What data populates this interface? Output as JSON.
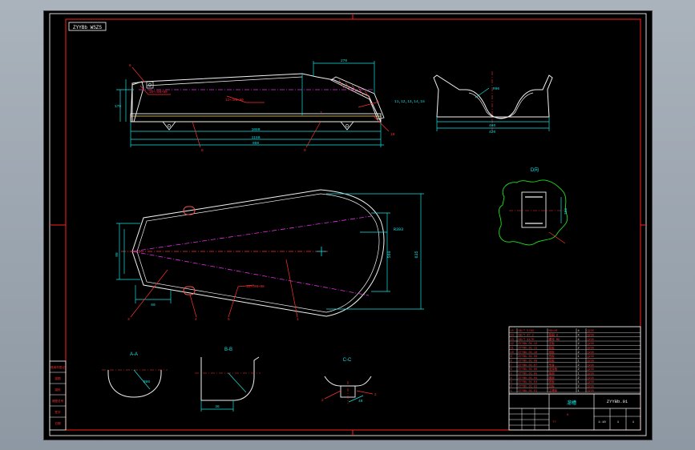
{
  "sheet": {
    "drawing_number_box": "ZYYBb WSZS"
  },
  "side_view": {
    "dims": {
      "top_len": "270",
      "overall_len_1": "1080",
      "overall_len_2": "1180",
      "inner_len": "950",
      "left_height": "170",
      "slope_note": "11,12,13,14,15"
    },
    "leaders": {
      "weld_1": "10×∠90×90",
      "weld_2": "12×∠80×80",
      "item_6": "6",
      "item_7": "7",
      "item_8": "8",
      "item_9": "9",
      "item_10": "10",
      "item_11": "11",
      "item_12": "12",
      "item_13": "13",
      "item_14": "14"
    }
  },
  "end_view": {
    "dims": {
      "width": "480",
      "inner_width": "420",
      "radius": "R96"
    }
  },
  "plan_view": {
    "dims": {
      "R": "R393",
      "width_560": "560",
      "width_635": "635",
      "left_w": "80",
      "offset": "60"
    },
    "leaders": {
      "item_1": "1",
      "item_2": "2",
      "item_4": "4",
      "item_5": "5",
      "item_3": "3",
      "weld": "16×∠90×90"
    }
  },
  "detail_d": {
    "label": "D向",
    "dim": "100"
  },
  "sections": {
    "aa": {
      "label": "A-A",
      "dim": "R86"
    },
    "bb": {
      "label": "B-B",
      "dim": "36"
    },
    "cc": {
      "label": "C-C",
      "leader_left": "2",
      "leader_right": "2",
      "dim": "40"
    }
  },
  "title_block": {
    "parts_rows": [
      [
        "15",
        "GB/T 5783",
        "M8×20",
        "4",
        "Q235"
      ],
      [
        "14",
        "GB/T 97.1",
        "垫圈 8",
        "4",
        "Q235"
      ],
      [
        "13",
        "GB/T 6170",
        "螺母 M8",
        "4",
        "Q235"
      ],
      [
        "12",
        "ZYYBb.01-12",
        "支板",
        "2",
        "Q235"
      ],
      [
        "11",
        "ZYYBb.01-11",
        "筋板",
        "2",
        "Q235"
      ],
      [
        "10",
        "ZYYBb.01-10",
        "侧板",
        "2",
        "Q235"
      ],
      [
        "9",
        "ZYYBb.01-09",
        "挡板",
        "1",
        "Q235"
      ],
      [
        "8",
        "ZYYBb.01-08",
        "底板",
        "1",
        "Q235"
      ],
      [
        "7",
        "ZYYBb.01-07",
        "吊耳",
        "2",
        "Q235"
      ],
      [
        "6",
        "ZYYBb.01-06",
        "连接板",
        "2",
        "Q235"
      ],
      [
        "5",
        "ZYYBb.01-05",
        "角钢",
        "1",
        "Q235"
      ],
      [
        "4",
        "ZYYBb.01-04",
        "圆钢",
        "2",
        "Q235"
      ],
      [
        "3",
        "ZYYBb.01-03",
        "弧板",
        "1",
        "Q235"
      ],
      [
        "2",
        "ZYYBb.01-02",
        "耳板",
        "2",
        "Q235"
      ],
      [
        "1",
        "ZYYBb.01-01",
        "主槽体",
        "1",
        "Q235"
      ]
    ],
    "name": "溜槽",
    "code": "ZYYBb.01",
    "scale": "1:10",
    "sheet": "1",
    "sheets": "1",
    "small_labels": [
      "S",
      "P",
      "?",
      "?",
      "??"
    ]
  },
  "left_strip": {
    "cells": [
      "借用件登记",
      "描图",
      "描校",
      "底图总号",
      "签字",
      "日期"
    ]
  }
}
